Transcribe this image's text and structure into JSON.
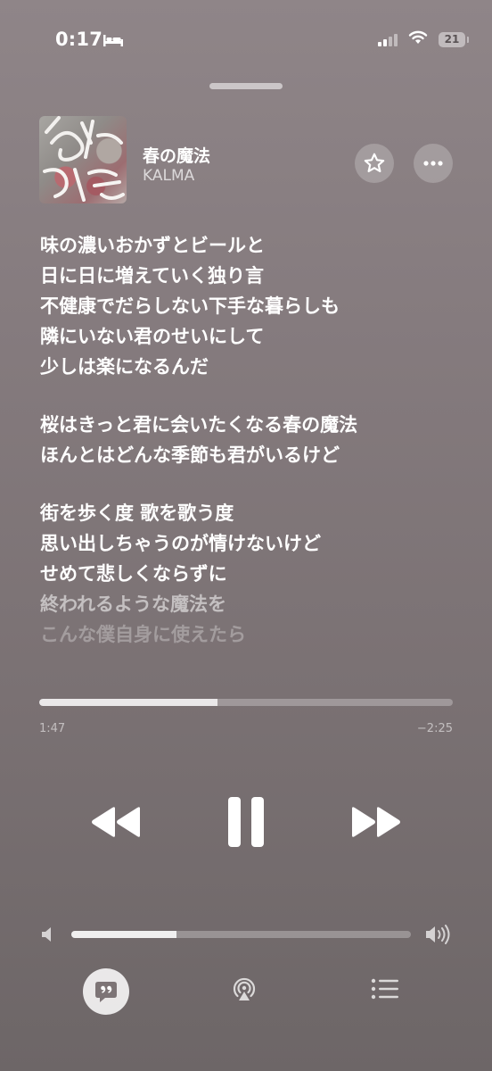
{
  "status_bar": {
    "time": "0:17",
    "battery": "21"
  },
  "now_playing": {
    "title": "春の魔法",
    "artist": "KALMA"
  },
  "lyrics": {
    "stanzas": [
      {
        "lines": [
          "味の濃いおかずとビールと",
          "日に日に増えていく独り言",
          "不健康でだらしない下手な暮らしも",
          "隣にいない君のせいにして",
          "少しは楽になるんだ"
        ]
      },
      {
        "lines": [
          "桜はきっと君に会いたくなる春の魔法",
          "ほんとはどんな季節も君がいるけど"
        ]
      },
      {
        "lines": [
          "街を歩く度 歌を歌う度",
          "思い出しちゃうのが情けないけど",
          "せめて悲しくならずに",
          "終われるような魔法を",
          "こんな僕自身に使えたら"
        ]
      }
    ]
  },
  "playback": {
    "elapsed": "1:47",
    "remaining": "−2:25",
    "progress_fraction": 0.43
  },
  "volume": {
    "level_fraction": 0.31
  },
  "icons": {
    "sleep": "bed-icon",
    "signal": "cellular-signal-icon",
    "wifi": "wifi-icon",
    "favorite": "star-icon",
    "more": "ellipsis-icon",
    "rewind": "rewind-icon",
    "pause": "pause-icon",
    "forward": "fast-forward-icon",
    "volume_low": "speaker-low-icon",
    "volume_high": "speaker-high-icon",
    "lyrics": "lyrics-quote-icon",
    "airplay": "airplay-icon",
    "queue": "queue-list-icon"
  },
  "colors": {
    "background": "#857b7e",
    "text": "#ffffff"
  }
}
